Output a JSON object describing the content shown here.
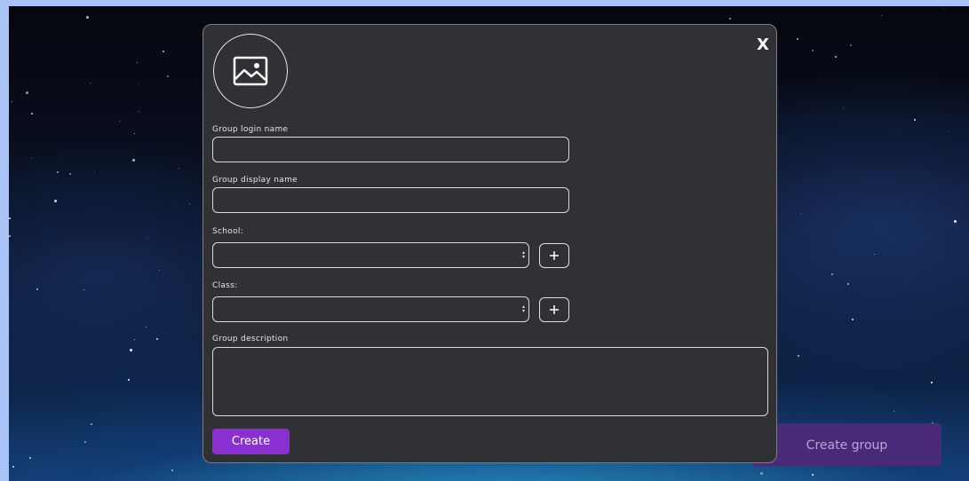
{
  "background": {
    "create_group_label": "Create group"
  },
  "modal": {
    "close_label": "X",
    "avatar_icon": "image-icon",
    "login_name": {
      "label": "Group login name",
      "value": ""
    },
    "display_name": {
      "label": "Group display name",
      "value": ""
    },
    "school": {
      "label": "School:",
      "selected": ""
    },
    "class": {
      "label": "Class:",
      "selected": ""
    },
    "description": {
      "label": "Group description",
      "value": ""
    },
    "create_label": "Create"
  },
  "colors": {
    "accent": "#8a2fd1",
    "modal_bg": "#2f3135",
    "frame": "#a9c3f7"
  }
}
